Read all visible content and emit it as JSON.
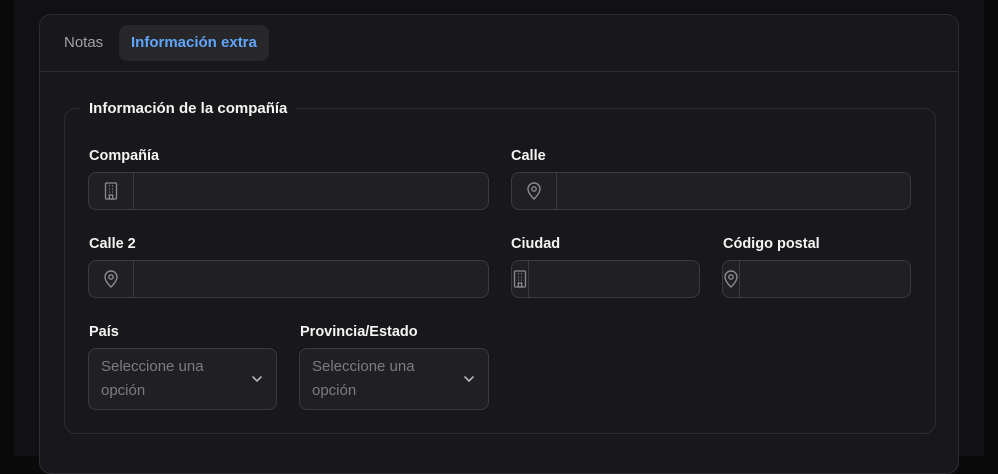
{
  "tabs": [
    {
      "label": "Notas",
      "active": false
    },
    {
      "label": "Información extra",
      "active": true
    }
  ],
  "section": {
    "title": "Información de la compañía"
  },
  "fields": {
    "company": {
      "label": "Compañía",
      "value": "",
      "icon": "building-icon"
    },
    "street": {
      "label": "Calle",
      "value": "",
      "icon": "map-pin-icon"
    },
    "street2": {
      "label": "Calle 2",
      "value": "",
      "icon": "map-pin-icon"
    },
    "city": {
      "label": "Ciudad",
      "value": "",
      "icon": "building-icon"
    },
    "postal": {
      "label": "Código postal",
      "value": "",
      "icon": "map-pin-icon"
    },
    "country": {
      "label": "País",
      "placeholder": "Seleccione una opción"
    },
    "state": {
      "label": "Provincia/Estado",
      "placeholder": "Seleccione una opción"
    }
  },
  "colors": {
    "accent": "#60a5fa",
    "background": "#18181b",
    "border": "#2c2c31"
  }
}
